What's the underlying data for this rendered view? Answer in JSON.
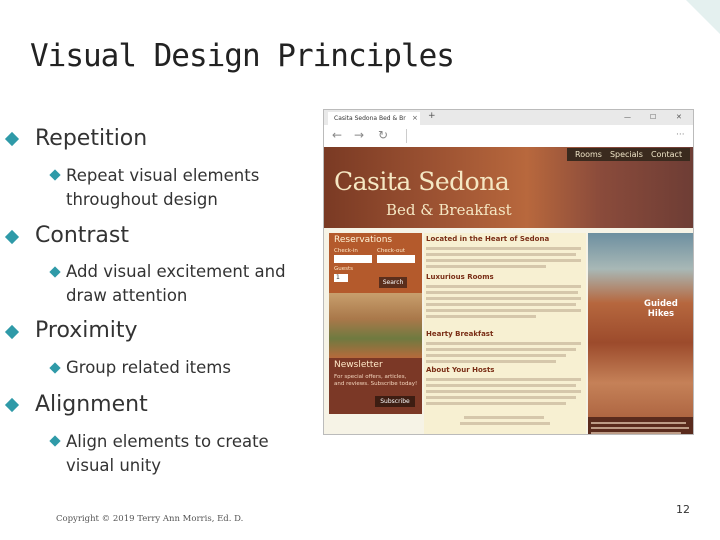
{
  "slide": {
    "title": "Visual Design Principles",
    "bullets": [
      {
        "label": "Repetition",
        "sub": "Repeat visual elements throughout design"
      },
      {
        "label": "Contrast",
        "sub": "Add visual excitement and draw attention"
      },
      {
        "label": "Proximity",
        "sub": "Group related items"
      },
      {
        "label": "Alignment",
        "sub": "Align elements to create visual unity"
      }
    ],
    "footer": "Copyright © 2019 Terry Ann Morris, Ed. D.",
    "page_number": "12"
  },
  "browser": {
    "tab_title": "Casita Sedona Bed & Br",
    "tab_close": "×",
    "new_tab": "+",
    "nav": {
      "back": "←",
      "forward": "→",
      "reload": "↻",
      "menu": "···"
    },
    "window_controls": {
      "minimize": "—",
      "maximize": "☐",
      "close": "✕"
    }
  },
  "website": {
    "nav_links": [
      "Rooms",
      "Specials",
      "Contact"
    ],
    "logo_line1": "Casita Sedona",
    "logo_line2": "Bed & Breakfast",
    "reservations": {
      "heading": "Reservations",
      "checkin": "Check-in",
      "checkout": "Check-out",
      "guests": "Guests",
      "guests_value": "1",
      "button": "Search"
    },
    "newsletter": {
      "heading": "Newsletter",
      "line1": "For special offers, articles,",
      "line2": "and reviews. Subscribe today!",
      "button": "Subscribe"
    },
    "sections": [
      "Located in the Heart of Sedona",
      "Luxurious Rooms",
      "Hearty Breakfast",
      "About Your Hosts"
    ],
    "guided_hikes": "Guided\nHikes"
  },
  "colors": {
    "accent": "#2f9aa8",
    "site_brown": "#7b3826",
    "site_orange": "#b45a2c",
    "site_cream": "#f7f0d2"
  }
}
